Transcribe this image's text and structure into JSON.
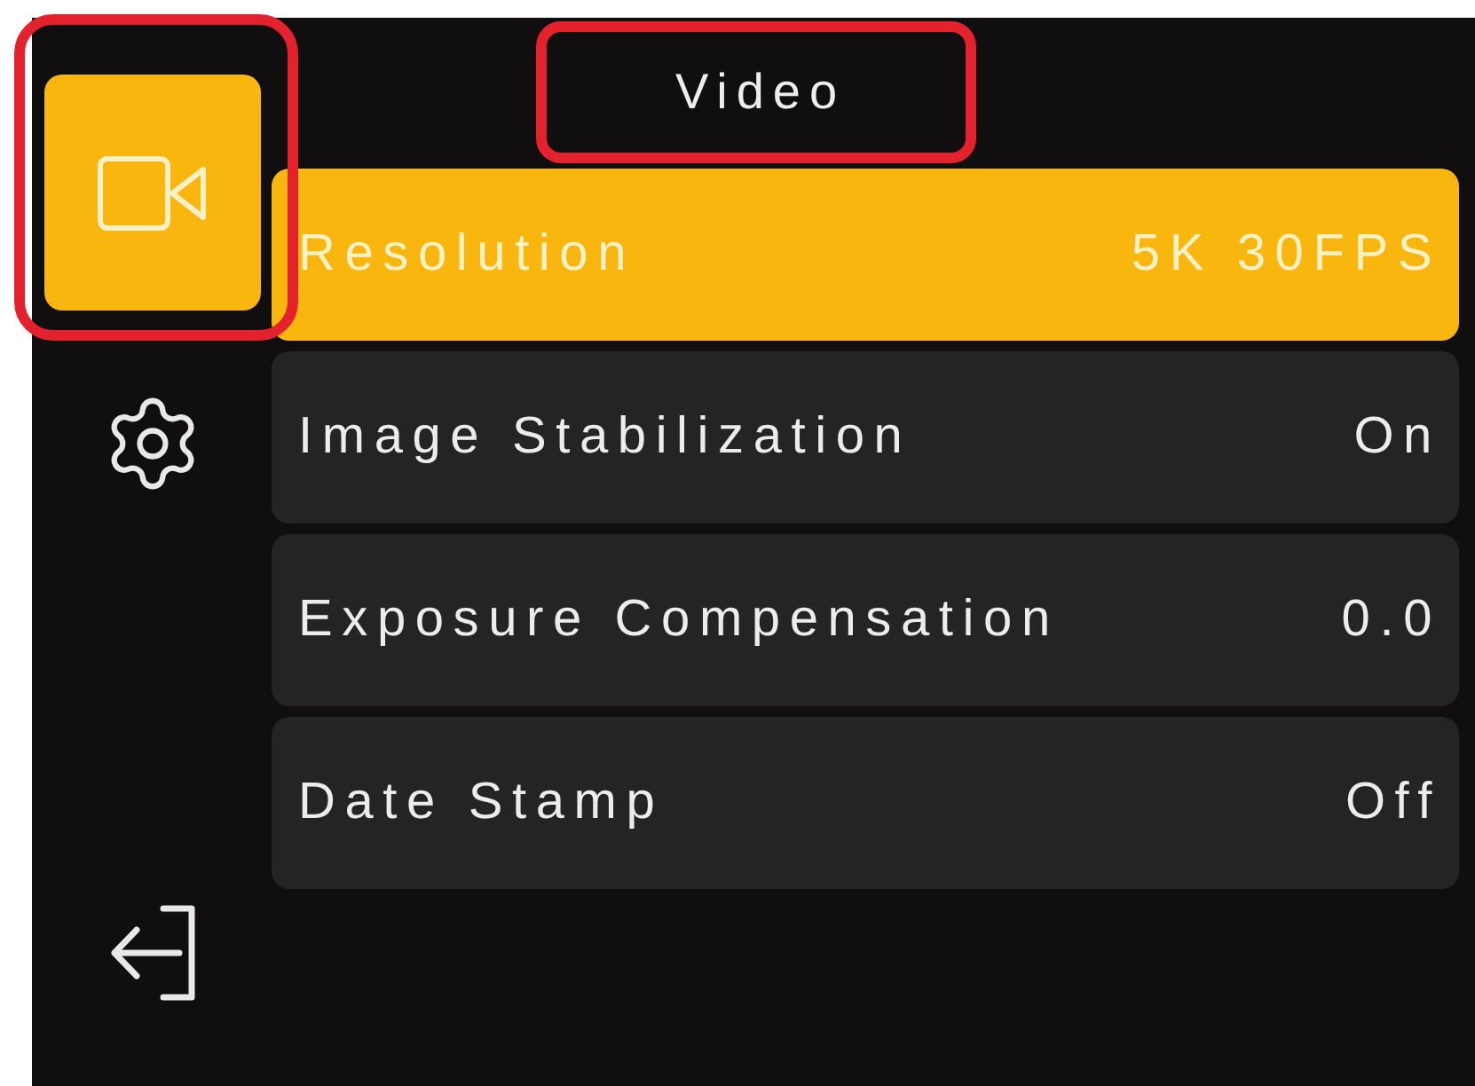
{
  "title": {
    "text": "Video",
    "callout": true
  },
  "sidebar": {
    "items": [
      {
        "kind": "video",
        "selected": true,
        "callout": true
      },
      {
        "kind": "settings",
        "selected": false,
        "callout": false
      },
      {
        "kind": "exit",
        "selected": false,
        "callout": false
      }
    ]
  },
  "menu": {
    "rows": [
      {
        "label": "Resolution",
        "value": "5K 30FPS",
        "selected": true
      },
      {
        "label": "Image Stabilization",
        "value": "On",
        "selected": false
      },
      {
        "label": "Exposure Compensation",
        "value": "0.0",
        "selected": false
      },
      {
        "label": "Date Stamp",
        "value": "Off",
        "selected": false
      }
    ]
  }
}
